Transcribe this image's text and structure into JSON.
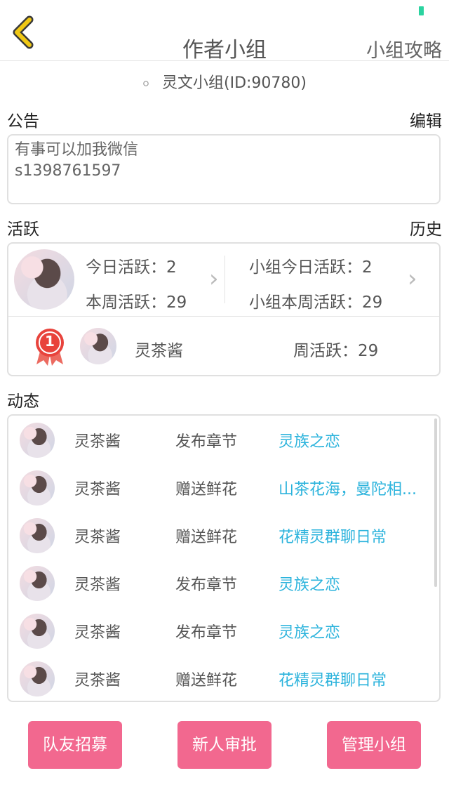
{
  "header": {
    "title": "作者小组",
    "guide_label": "小组攻略",
    "back_icon": "chevron-left-icon",
    "accent": "#f0c814"
  },
  "group": {
    "name_id": "灵文小组(ID:90780)"
  },
  "notice": {
    "label": "公告",
    "edit_label": "编辑",
    "text": "有事可以加我微信\ns1398761597"
  },
  "activity": {
    "label": "活跃",
    "history_label": "历史",
    "today": "今日活跃：2",
    "week": "本周活跃：29",
    "group_today": "小组今日活跃：2",
    "group_week": "小组本周活跃：29",
    "rank": {
      "badge": "1",
      "user": "灵茶酱",
      "weekly": "周活跃：29"
    }
  },
  "feed": {
    "label": "动态",
    "items": [
      {
        "user": "灵茶酱",
        "action": "发布章节",
        "target": "灵族之恋"
      },
      {
        "user": "灵茶酱",
        "action": "赠送鲜花",
        "target": "山茶花海，曼陀相..."
      },
      {
        "user": "灵茶酱",
        "action": "赠送鲜花",
        "target": "花精灵群聊日常"
      },
      {
        "user": "灵茶酱",
        "action": "发布章节",
        "target": "灵族之恋"
      },
      {
        "user": "灵茶酱",
        "action": "发布章节",
        "target": "灵族之恋"
      },
      {
        "user": "灵茶酱",
        "action": "赠送鲜花",
        "target": "花精灵群聊日常"
      }
    ]
  },
  "buttons": {
    "recruit": "队友招募",
    "approve": "新人审批",
    "manage": "管理小组",
    "color": "#f2688f"
  },
  "colors": {
    "link": "#2bb3dc",
    "badge": "#e8433c"
  }
}
